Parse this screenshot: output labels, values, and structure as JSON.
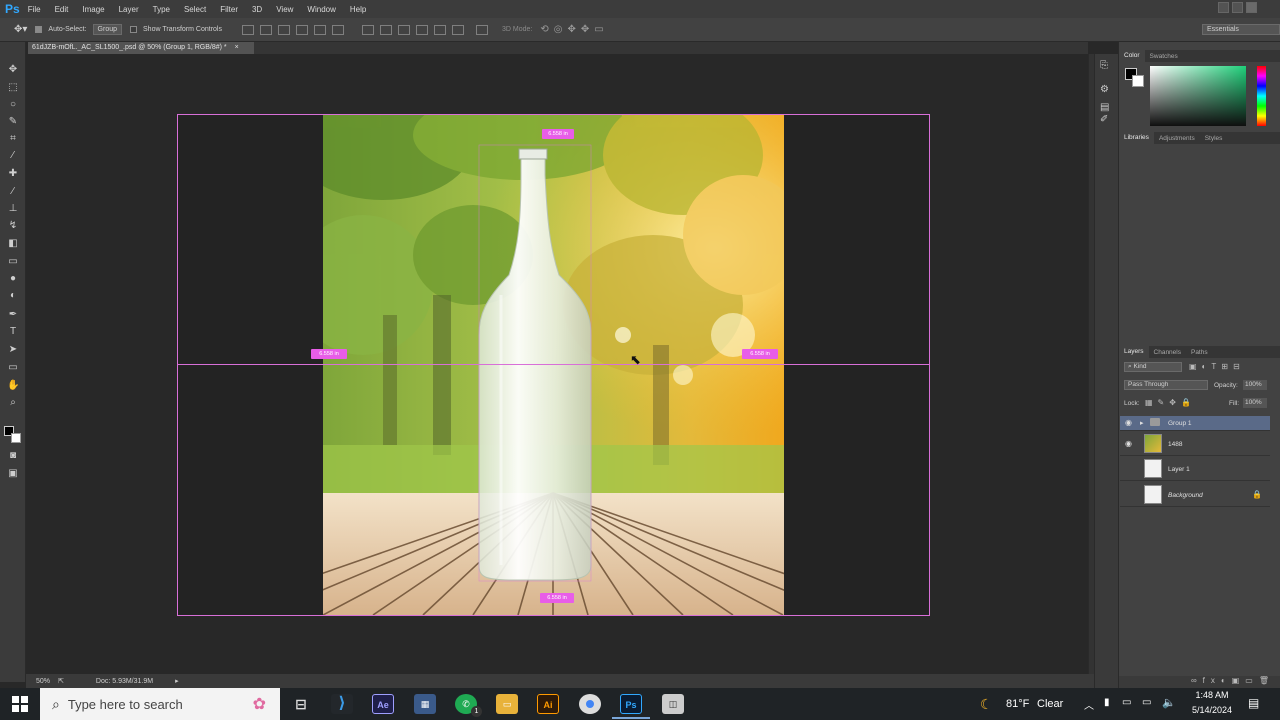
{
  "menubar": {
    "logo": "Ps",
    "items": [
      "File",
      "Edit",
      "Image",
      "Layer",
      "Type",
      "Select",
      "Filter",
      "3D",
      "View",
      "Window",
      "Help"
    ]
  },
  "options": {
    "auto_select_label": "Auto-Select:",
    "auto_select_value": "Group",
    "transform_label": "Show Transform Controls",
    "mode3d_label": "3D Mode:",
    "workspace": "Essentials"
  },
  "document": {
    "tab_title": "61dJZB-mOfL._AC_SL1500_.psd @ 50% (Group 1, RGB/8#) *",
    "close": "×"
  },
  "guides": {
    "top_label": "6.558 in",
    "left_label": "6.558 in",
    "right_label": "6.558 in",
    "bottom_label": "6.558 in"
  },
  "status": {
    "zoom": "50%",
    "doc": "Doc: 5.93M/31.9M"
  },
  "color_panel": {
    "tabs": [
      "Color",
      "Swatches"
    ],
    "gradient_start": "#0f0f0f",
    "gradient_hue": "#1fd07a"
  },
  "libraries_panel": {
    "tabs": [
      "Libraries",
      "Adjustments",
      "Styles"
    ]
  },
  "layers_panel": {
    "tabs": [
      "Layers",
      "Channels",
      "Paths"
    ],
    "filter_kind": "Kind",
    "blend_mode": "Pass Through",
    "opacity_label": "Opacity:",
    "opacity_value": "100%",
    "lock_label": "Lock:",
    "fill_label": "Fill:",
    "fill_value": "100%",
    "layers": [
      {
        "name": "Group 1",
        "visible": true,
        "selected": true
      },
      {
        "name": "1488",
        "visible": true,
        "selected": false
      },
      {
        "name": "Layer 1",
        "visible": false,
        "selected": false
      },
      {
        "name": "Background",
        "visible": false,
        "selected": false
      }
    ]
  },
  "taskbar": {
    "search_placeholder": "Type here to search",
    "weather_temp": "81°F",
    "weather_cond": "Clear",
    "time": "1:48 AM",
    "date": "5/14/2024",
    "whatsapp_badge": "1"
  }
}
